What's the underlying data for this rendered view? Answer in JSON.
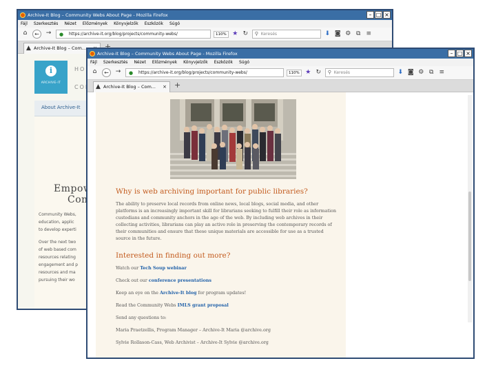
{
  "back_window": {
    "title": "Archive-It Blog – Community Webs About Page - Mozilla Firefox",
    "menu": [
      "Fájl",
      "Szerkesztés",
      "Nézet",
      "Előzmények",
      "Könyvjelzők",
      "Eszközök",
      "Súgó"
    ],
    "url": "https://archive-it.org/blog/projects/community-webs/",
    "zoom": "110%",
    "search_placeholder": "Keresés",
    "tab_label": "Archive-It Blog – Com...",
    "logo_text": "ARCHIVE-IT",
    "nav_home": "HOME",
    "nav_contact": "CONTA",
    "about_link": "About Archive-It",
    "heading_line1": "Empow",
    "heading_line2": "Com",
    "text_lines": [
      "Community Webs,",
      "education, applic",
      "to develop experti",
      "",
      "Over the next two",
      "of web based com",
      "resources relating",
      "engagement and p",
      "resources and ma",
      "pursuing their wo"
    ]
  },
  "front_window": {
    "title": "Archive-It Blog – Community Webs About Page - Mozilla Firefox",
    "menu": [
      "Fájl",
      "Szerkesztés",
      "Nézet",
      "Előzmények",
      "Könyvjelzők",
      "Eszközök",
      "Súgó"
    ],
    "url": "https://archive-it.org/blog/projects/community-webs/",
    "zoom": "110%",
    "search_placeholder": "Keresés",
    "tab_label": "Archive-It Blog – Com...",
    "article": {
      "heading1": "Why is web archiving important for public libraries?",
      "paragraph": "The ability to preserve local records from online news, local blogs, social media, and other platforms is an increasingly important skill for librarians seeking to fulfill their role as information custodians and community anchors in the age of the web. By including web archives in their collecting activities, librarians can play an active role in preserving the contemporary records of their communities and ensure that these unique materials are accessible for use as a trusted source in the future.",
      "heading2": "Interested in finding out more?",
      "watch_prefix": "Watch our",
      "watch_link": "Tech Soup webinar",
      "checkout_prefix": "Check out our",
      "checkout_link": "conference presentations",
      "keep_prefix": "Keep an eye on the",
      "keep_link": "Archive-It blog",
      "keep_suffix": "for program updates!",
      "read_prefix": "Read the Community Webs",
      "read_link": "IMLS grant proposal",
      "questions": "Send any questions to:",
      "contact1": "Maria Praetzellis, Program Manager – Archive-It  Maria @archive.org",
      "contact2": "Sylvie Rollason-Cass, Web Archivist – Archive-It  Sylvie @archive.org"
    }
  },
  "colors": {
    "titlebar": "#3a6ea5",
    "heading": "#c35b1e",
    "link": "#1e5fa8",
    "page_bg": "#faf5eb",
    "logo": "#38a3c9"
  }
}
